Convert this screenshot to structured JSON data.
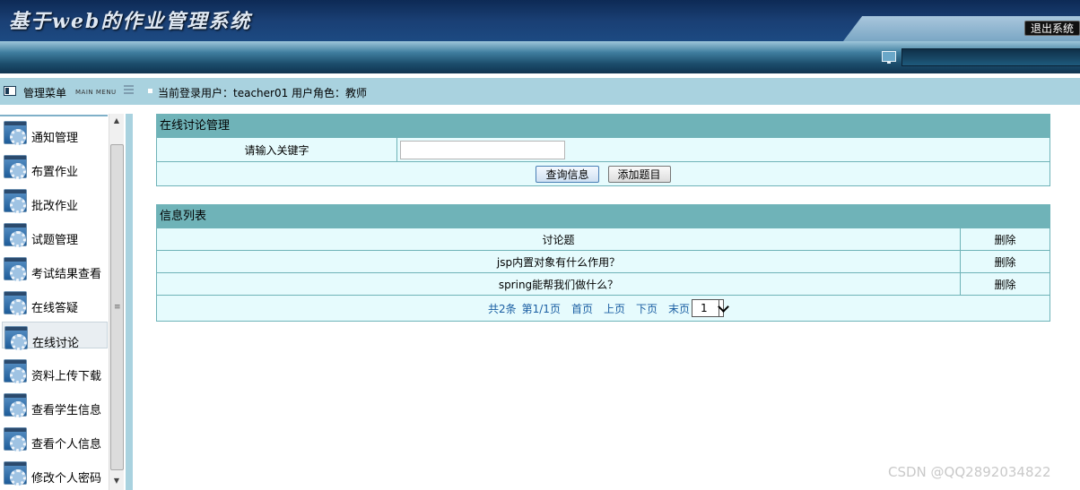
{
  "header": {
    "title": "基于web的作业管理系统",
    "logout_label": "退出系统"
  },
  "menubar": {
    "menu_title": "管理菜单",
    "menu_subtitle": "MAIN MENU",
    "user_info": "当前登录用户：teacher01 用户角色：教师"
  },
  "sidebar": {
    "active_index": 6,
    "items": [
      {
        "label": "通知管理",
        "icon": "gear-window-icon"
      },
      {
        "label": "布置作业",
        "icon": "gear-window-icon"
      },
      {
        "label": "批改作业",
        "icon": "gear-window-icon"
      },
      {
        "label": "试题管理",
        "icon": "gear-window-icon"
      },
      {
        "label": "考试结果查看",
        "icon": "gear-window-icon"
      },
      {
        "label": "在线答疑",
        "icon": "gear-window-icon"
      },
      {
        "label": "在线讨论",
        "icon": "gear-window-icon"
      },
      {
        "label": "资料上传下载",
        "icon": "gear-window-icon"
      },
      {
        "label": "查看学生信息",
        "icon": "gear-window-icon"
      },
      {
        "label": "查看个人信息",
        "icon": "gear-window-icon"
      },
      {
        "label": "修改个人密码",
        "icon": "gear-window-icon"
      }
    ]
  },
  "search_panel": {
    "title": "在线讨论管理",
    "keyword_label": "请输入关键字",
    "keyword_value": "",
    "query_button": "查询信息",
    "add_button": "添加题目"
  },
  "list_panel": {
    "title": "信息列表",
    "columns": [
      "讨论题",
      "删除"
    ],
    "rows": [
      {
        "topic": "jsp内置对象有什么作用？",
        "action": "删除"
      },
      {
        "topic": "spring能帮我们做什么？",
        "action": "删除"
      }
    ],
    "pager": {
      "total": "共2条",
      "page_info": "第1/1页",
      "first": "首页",
      "prev": "上页",
      "next": "下页",
      "last": "末页",
      "selected_page": "1"
    }
  },
  "watermark": "CSDN @QQ2892034822",
  "colors": {
    "header_dark": "#0d2a55",
    "menubar": "#a9d2df",
    "panel_head": "#6fb3b8",
    "row_bg": "#e6fbfd",
    "link": "#1b5fa3"
  }
}
